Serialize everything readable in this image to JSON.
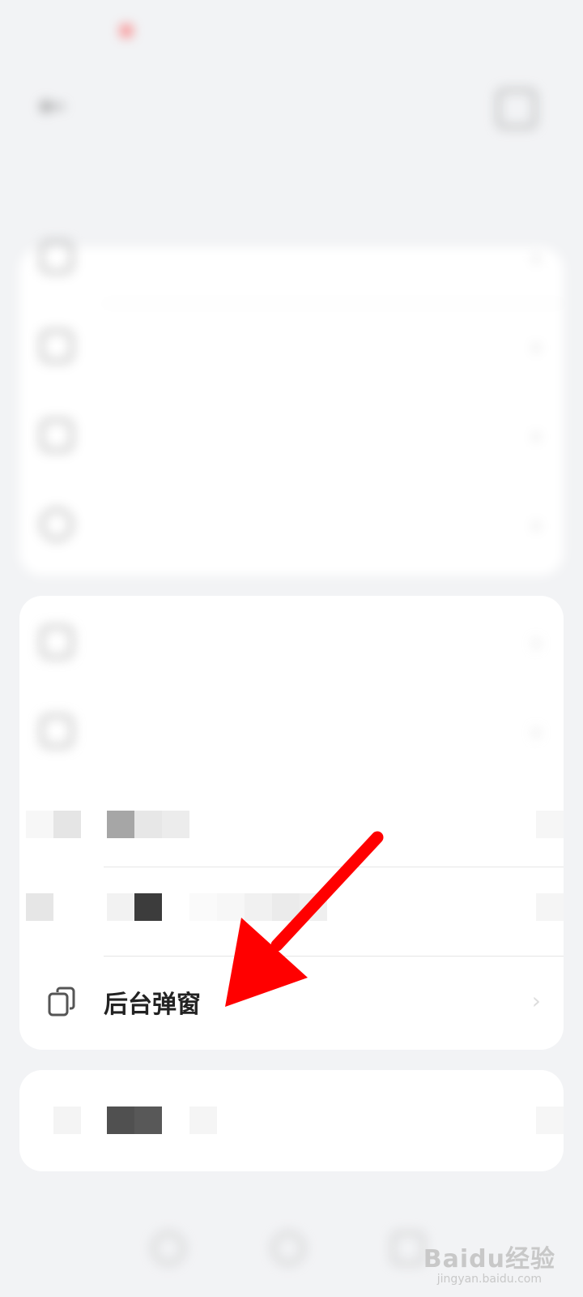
{
  "status_bar": {
    "time": "",
    "right_icons": ""
  },
  "header": {
    "title": "",
    "back_icon": "back-arrow-icon",
    "menu_icon": "more-icon"
  },
  "tabs": [
    {
      "label": "",
      "active": true
    },
    {
      "label": "",
      "active": false
    }
  ],
  "card1": {
    "items": [
      {
        "label": "",
        "icon": "app-icon"
      },
      {
        "label": "",
        "icon": "notification-icon"
      },
      {
        "label": "",
        "icon": "shield-icon"
      },
      {
        "label": "",
        "icon": "clock-icon"
      }
    ]
  },
  "card2": {
    "items": [
      {
        "label": "",
        "icon": "window-icon"
      },
      {
        "label": "",
        "icon": "calendar-icon"
      }
    ],
    "highlighted_item": {
      "label": "后台弹窗",
      "icon": "background-popup-icon"
    }
  },
  "card3": {
    "items": [
      {
        "label": ""
      }
    ]
  },
  "watermark": {
    "brand": "Baidu经验",
    "site": "jingyan.baidu.com"
  },
  "colors": {
    "accent": "#3a6cf0",
    "annotation_arrow": "#ff0000",
    "background": "#f2f3f5"
  }
}
